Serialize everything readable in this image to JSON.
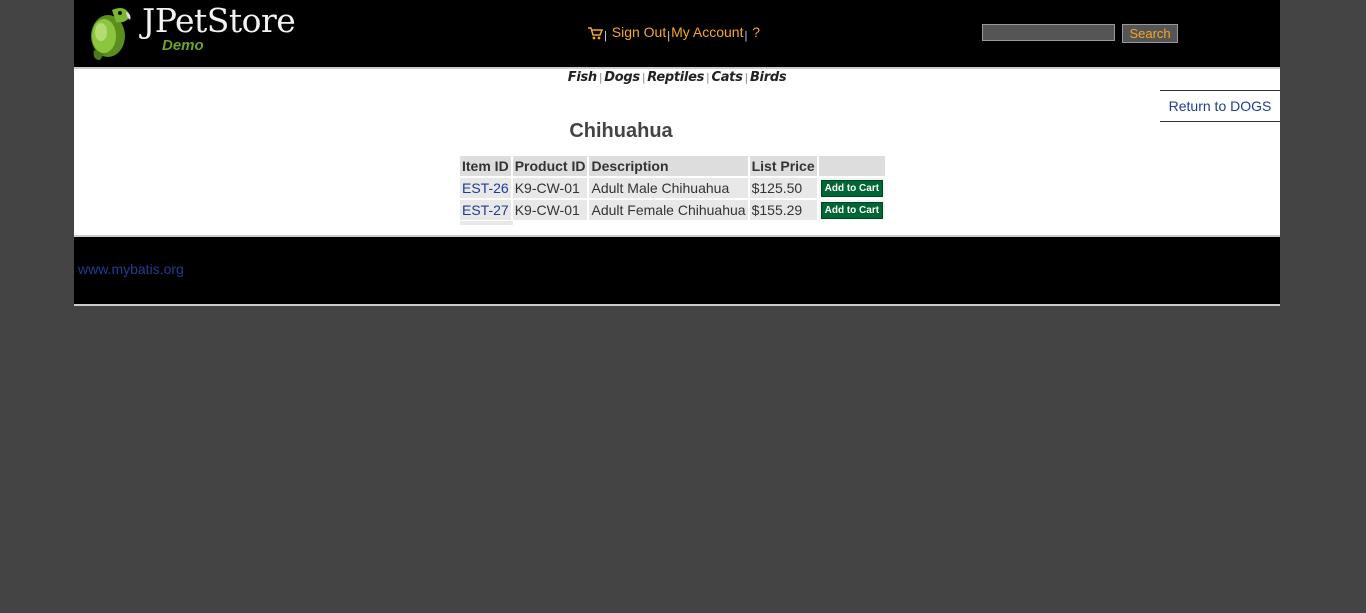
{
  "header": {
    "logo_text": "JPetStore",
    "logo_subtext": "Demo",
    "menu": {
      "cart_icon": "shopping-cart-icon",
      "sign_out": "Sign Out",
      "my_account": "My Account",
      "help": "?",
      "separator": "|"
    },
    "search": {
      "value": "",
      "button_label": "Search"
    }
  },
  "quicklinks": {
    "fish": "Fish",
    "dogs": "Dogs",
    "reptiles": "Reptiles",
    "cats": "Cats",
    "birds": "Birds",
    "separator": "|"
  },
  "return_link": "Return to DOGS",
  "product": {
    "title": "Chihuahua"
  },
  "table": {
    "headers": [
      "Item ID",
      "Product ID",
      "Description",
      "List Price",
      ""
    ],
    "rows": [
      {
        "item_id": "EST-26",
        "product_id": "K9-CW-01",
        "description": "Adult Male Chihuahua",
        "price": "$125.50",
        "action": "Add to Cart"
      },
      {
        "item_id": "EST-27",
        "product_id": "K9-CW-01",
        "description": "Adult Female Chihuahua",
        "price": "$155.29",
        "action": "Add to Cart"
      }
    ]
  },
  "footer": {
    "link": "www.mybatis.org"
  },
  "colors": {
    "page_bg": "#444444",
    "header_bg": "#000000",
    "menu_link": "#f5a623",
    "link_blue": "#1f3d91",
    "cart_button": "#006633"
  }
}
